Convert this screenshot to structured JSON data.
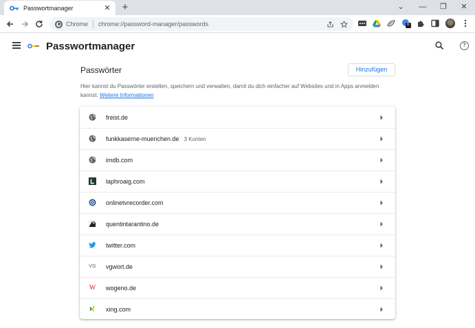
{
  "browser": {
    "tab_title": "Passwortmanager",
    "tab_close": "✕",
    "new_tab": "+",
    "omnibox_label": "Chrome",
    "url": "chrome://password-manager/passwords",
    "win_minimize": "⌄",
    "win_min2": "—",
    "win_restore": "❐",
    "win_close": "✕",
    "extension_badge": "0"
  },
  "app": {
    "title": "Passwortmanager"
  },
  "passwords": {
    "heading": "Passwörter",
    "add_button": "Hinzufügen",
    "description": "Hier kannst du Passwörter erstellen, speichern und verwalten, damit du dich einfacher auf Websites und in Apps anmelden kannst.",
    "learn_more": "Weitere Informationen",
    "items": [
      {
        "site": "freist.de",
        "count": "",
        "icon": "globe-icon"
      },
      {
        "site": "funkkaserne-muenchen.de",
        "count": "3 Konten",
        "icon": "globe-icon"
      },
      {
        "site": "imdb.com",
        "count": "",
        "icon": "globe-icon"
      },
      {
        "site": "laphroaig.com",
        "count": "",
        "icon": "laphroaig-icon"
      },
      {
        "site": "onlinetvrecorder.com",
        "count": "",
        "icon": "otr-icon"
      },
      {
        "site": "quentintarantino.de",
        "count": "",
        "icon": "tarantino-icon"
      },
      {
        "site": "twitter.com",
        "count": "",
        "icon": "twitter-bird-icon"
      },
      {
        "site": "vgwort.de",
        "count": "",
        "icon": "vg-icon"
      },
      {
        "site": "wogeno.de",
        "count": "",
        "icon": "wogeno-w-icon"
      },
      {
        "site": "xing.com",
        "count": "",
        "icon": "xing-icon"
      }
    ],
    "favicon_text": {
      "vg": "VG",
      "w": "W",
      "l": "L"
    }
  },
  "colors": {
    "accent": "#1a73e8",
    "tabstrip": "#dee1e6",
    "omnibox": "#f1f3f4",
    "twitter": "#1d9bf0",
    "xing_green": "#b0d400",
    "xing_teal": "#006567",
    "wogeno_red": "#d9232d",
    "laphroaig": "#1f3b2d"
  }
}
